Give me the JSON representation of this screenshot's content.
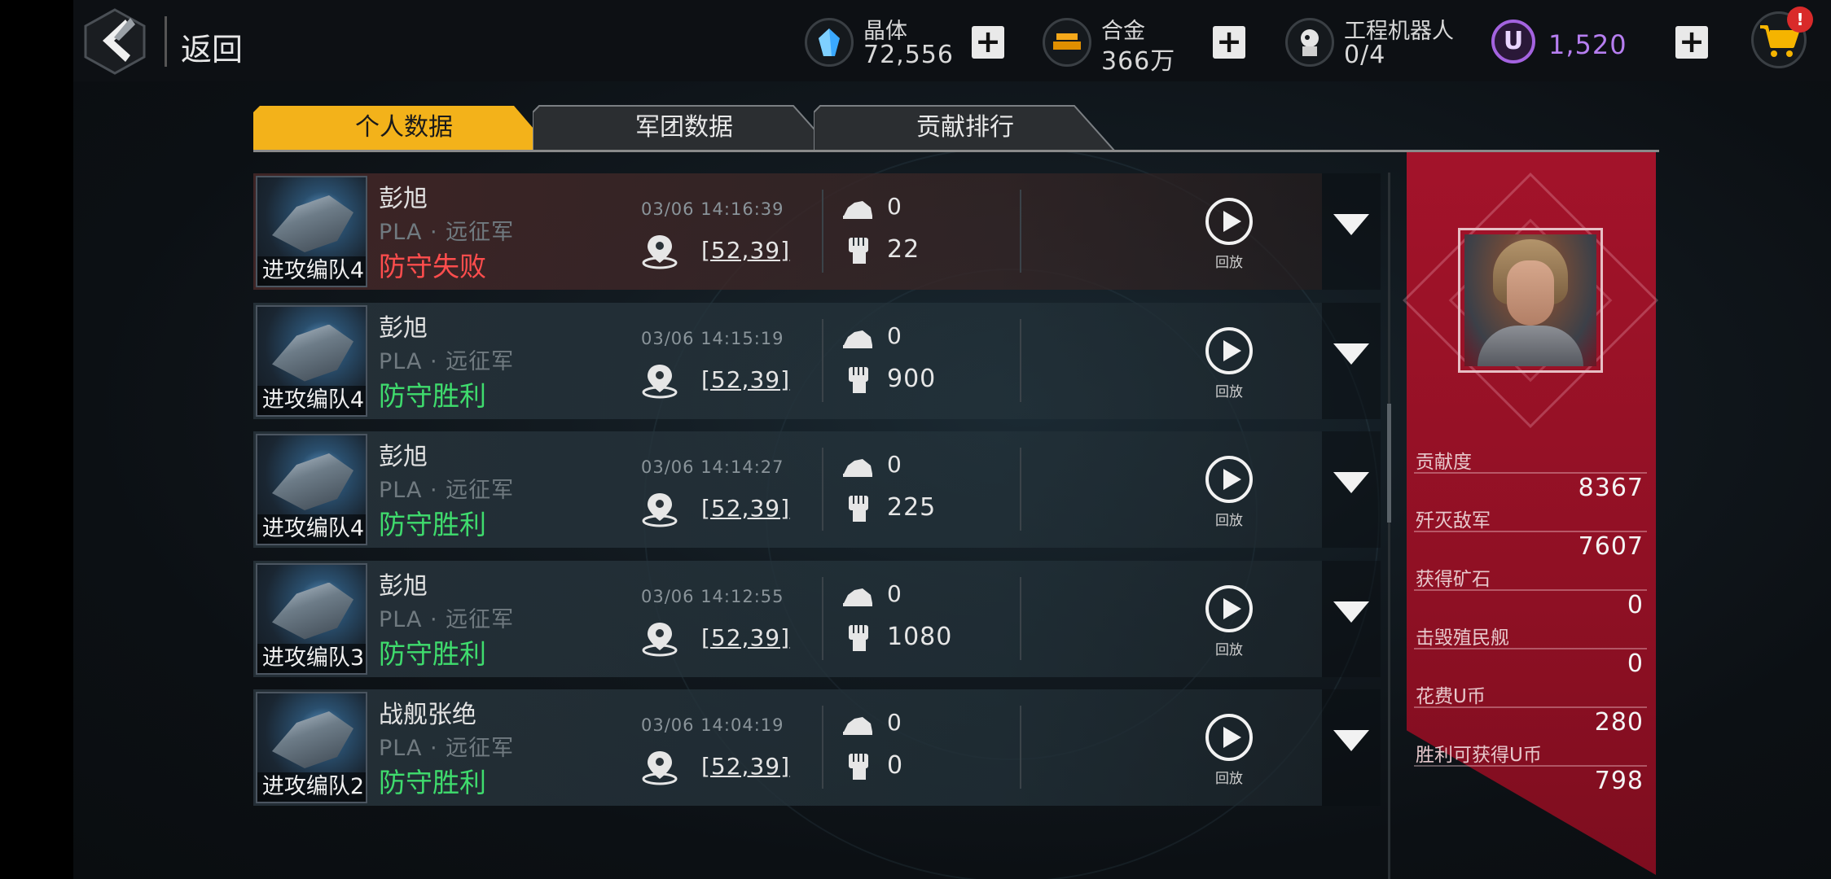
{
  "header": {
    "back_label": "返回",
    "resources": [
      {
        "name": "晶体",
        "value": "72,556",
        "icon": "crystal-icon",
        "color": "#38a8ff"
      },
      {
        "name": "合金",
        "value": "366万",
        "icon": "alloy-icon",
        "color": "#f2a012"
      },
      {
        "name": "工程机器人",
        "value": "0/4",
        "icon": "robot-icon"
      },
      {
        "name": "",
        "value": "1,520",
        "icon": "u-coin-icon",
        "color": "#9c59d1"
      }
    ],
    "cart_badge": "!"
  },
  "tabs": [
    {
      "label": "个人数据",
      "active": true
    },
    {
      "label": "军团数据",
      "active": false
    },
    {
      "label": "贡献排行",
      "active": false
    }
  ],
  "records": [
    {
      "fleet": "进攻编队4",
      "player": "彭旭",
      "guild": "PLA · 远征军",
      "result": "防守失败",
      "outcome": "lose",
      "time": "03/06 14:16:39",
      "coord": "[52,39]",
      "ore": "0",
      "power": "22",
      "replay": "回放"
    },
    {
      "fleet": "进攻编队4",
      "player": "彭旭",
      "guild": "PLA · 远征军",
      "result": "防守胜利",
      "outcome": "win",
      "time": "03/06 14:15:19",
      "coord": "[52,39]",
      "ore": "0",
      "power": "900",
      "replay": "回放"
    },
    {
      "fleet": "进攻编队4",
      "player": "彭旭",
      "guild": "PLA · 远征军",
      "result": "防守胜利",
      "outcome": "win",
      "time": "03/06 14:14:27",
      "coord": "[52,39]",
      "ore": "0",
      "power": "225",
      "replay": "回放"
    },
    {
      "fleet": "进攻编队3",
      "player": "彭旭",
      "guild": "PLA · 远征军",
      "result": "防守胜利",
      "outcome": "win",
      "time": "03/06 14:12:55",
      "coord": "[52,39]",
      "ore": "0",
      "power": "1080",
      "replay": "回放"
    },
    {
      "fleet": "进攻编队2",
      "player": "战舰张绝",
      "guild": "PLA · 远征军",
      "result": "防守胜利",
      "outcome": "win",
      "time": "03/06 14:04:19",
      "coord": "[52,39]",
      "ore": "0",
      "power": "0",
      "replay": "回放"
    }
  ],
  "stats": [
    {
      "label": "贡献度",
      "value": "8367"
    },
    {
      "label": "歼灭敌军",
      "value": "7607"
    },
    {
      "label": "获得矿石",
      "value": "0"
    },
    {
      "label": "击毁殖民舰",
      "value": "0"
    },
    {
      "label": "花费U币",
      "value": "280"
    },
    {
      "label": "胜利可获得U币",
      "value": "798"
    }
  ]
}
